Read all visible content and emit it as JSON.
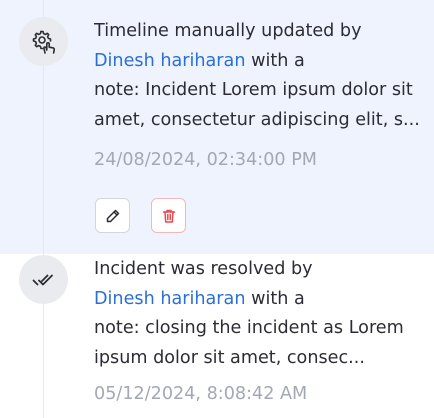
{
  "timeline": {
    "entries": [
      {
        "icon": "gear-hand-icon",
        "text_prefix": "Timeline manually updated by",
        "actor": "Dinesh hariharan",
        "actor_suffix": " with a",
        "note_line_1": "note: Incident Lorem ipsum dolor sit",
        "note_line_2": "amet, consectetur adipiscing elit, s...",
        "timestamp": "24/08/2024, 02:34:00 PM",
        "highlighted": true,
        "actions": [
          "edit-pencil-icon",
          "delete-trash-icon"
        ]
      },
      {
        "icon": "double-check-icon",
        "text_prefix": "Incident was resolved by",
        "actor": "Dinesh hariharan",
        "actor_suffix": " with a",
        "note_line_1": "note: closing the incident as Lorem",
        "note_line_2": "ipsum dolor sit amet, consec...",
        "timestamp": "05/12/2024, 8:08:42 AM",
        "highlighted": false
      }
    ]
  },
  "colors": {
    "highlight_bg": "#eef3fd",
    "actor_link": "#2a6fd6",
    "text": "#2c2c34",
    "muted": "#a3a8b4",
    "delete_red": "#e5484d"
  }
}
